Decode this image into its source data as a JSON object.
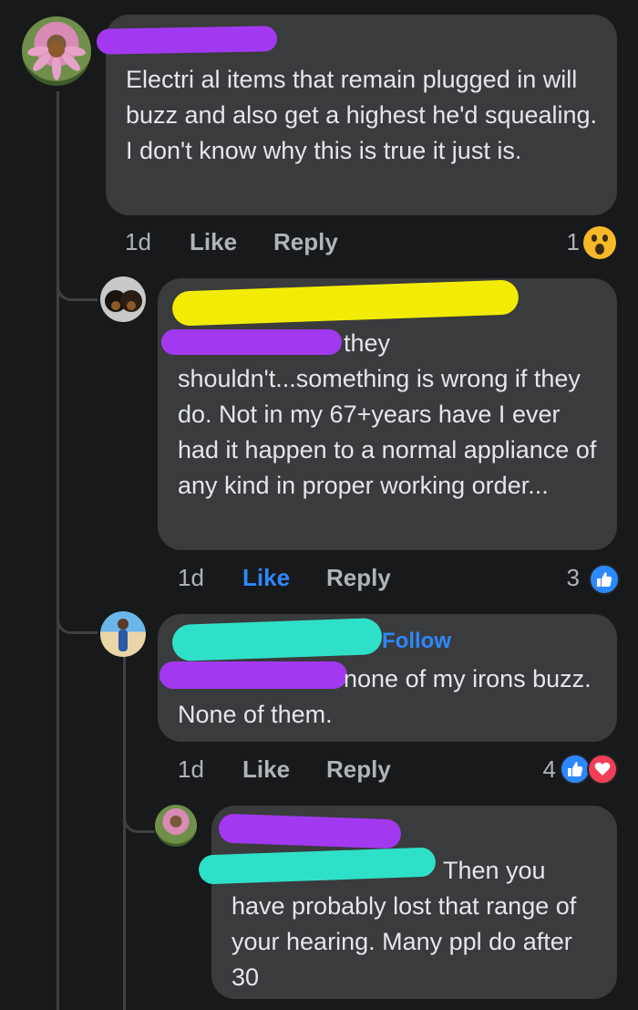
{
  "colors": {
    "background": "#18191a",
    "bubble": "#3a3b3c",
    "text": "#e4e6eb",
    "meta": "#b0b3b8",
    "like_blue": "#2d88ff",
    "love_red": "#f33e58",
    "redact_purple": "#a239f0",
    "redact_yellow": "#f2ec05",
    "redact_teal": "#2fe0c8"
  },
  "comments": [
    {
      "text": "Electri al items that remain plugged in will buzz and also get a highest he'd squealing. I don't know why this is true it just is.",
      "time": "1d",
      "like": "Like",
      "reply": "Reply",
      "reaction_count": "1",
      "reactions": [
        "wow-icon"
      ],
      "avatar": "coneflower-avatar"
    },
    {
      "text": "they shouldn't...something is wrong if they do.  Not in my 67+years have I ever had it happen to a normal appliance of any kind in proper working order...",
      "time": "1d",
      "like": "Like",
      "reply": "Reply",
      "reaction_count": "3",
      "reactions": [
        "like-icon"
      ],
      "avatar": "dogs-avatar",
      "like_active": true
    },
    {
      "follow": "Follow",
      "text": "none of my irons buzz. None of them.",
      "time": "1d",
      "like": "Like",
      "reply": "Reply",
      "reaction_count": "4",
      "reactions": [
        "like-icon",
        "love-icon"
      ],
      "avatar": "beach-avatar"
    },
    {
      "text": "Then you have probably lost that range of your hearing. Many ppl do after 30",
      "avatar": "coneflower-avatar"
    }
  ]
}
